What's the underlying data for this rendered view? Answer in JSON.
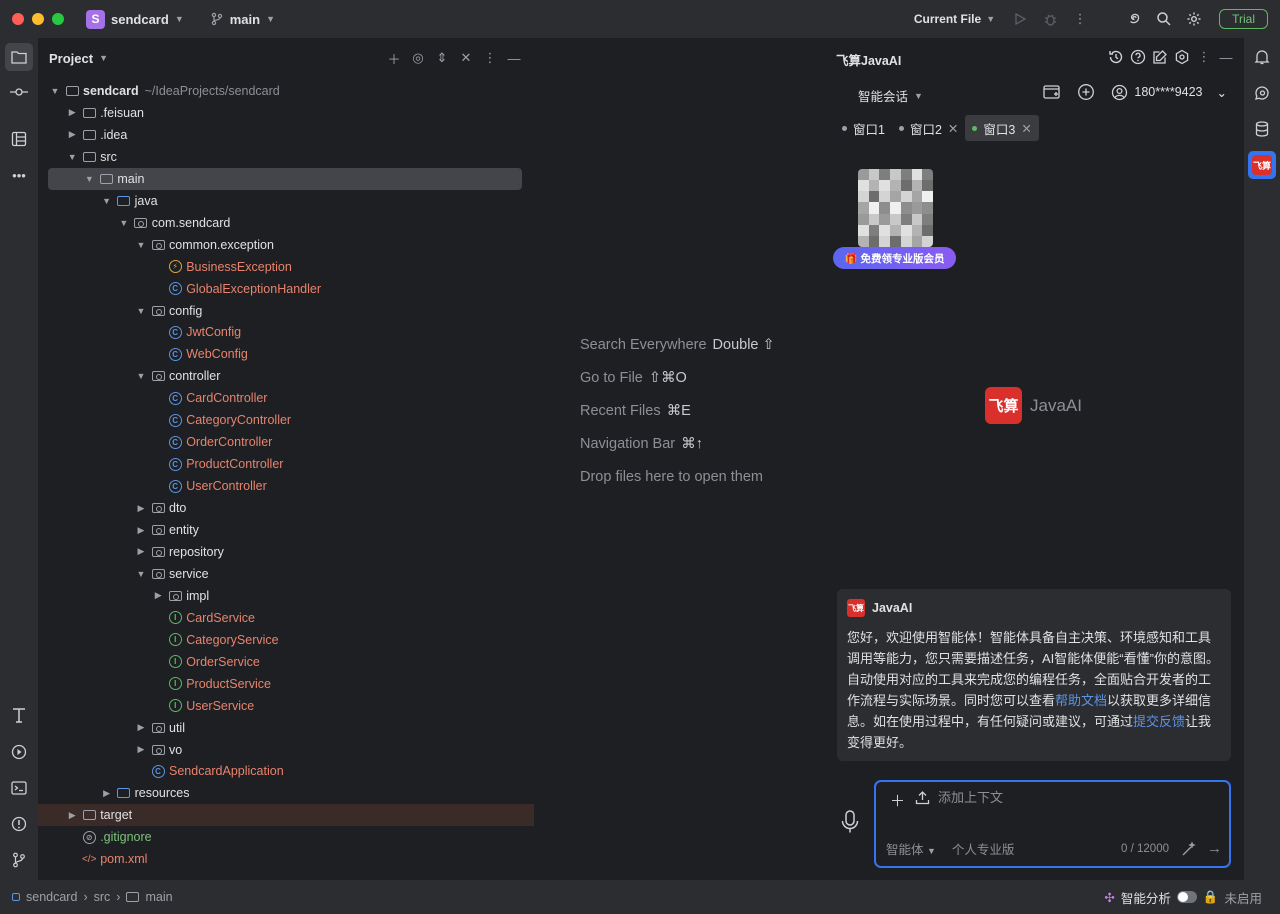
{
  "titlebar": {
    "project_initial": "S",
    "project_name": "sendcard",
    "branch": "main",
    "run_config": "Current File",
    "trial_label": "Trial"
  },
  "project_panel": {
    "title": "Project",
    "root_name": "sendcard",
    "root_path": "~/IdeaProjects/sendcard",
    "items": [
      {
        "label": ".feisuan"
      },
      {
        "label": ".idea"
      },
      {
        "label": "src"
      },
      {
        "label": "main"
      },
      {
        "label": "java"
      },
      {
        "label": "com.sendcard"
      },
      {
        "label": "common.exception"
      },
      {
        "label": "BusinessException"
      },
      {
        "label": "GlobalExceptionHandler"
      },
      {
        "label": "config"
      },
      {
        "label": "JwtConfig"
      },
      {
        "label": "WebConfig"
      },
      {
        "label": "controller"
      },
      {
        "label": "CardController"
      },
      {
        "label": "CategoryController"
      },
      {
        "label": "OrderController"
      },
      {
        "label": "ProductController"
      },
      {
        "label": "UserController"
      },
      {
        "label": "dto"
      },
      {
        "label": "entity"
      },
      {
        "label": "repository"
      },
      {
        "label": "service"
      },
      {
        "label": "impl"
      },
      {
        "label": "CardService"
      },
      {
        "label": "CategoryService"
      },
      {
        "label": "OrderService"
      },
      {
        "label": "ProductService"
      },
      {
        "label": "UserService"
      },
      {
        "label": "util"
      },
      {
        "label": "vo"
      },
      {
        "label": "SendcardApplication"
      },
      {
        "label": "resources"
      },
      {
        "label": "target"
      },
      {
        "label": ".gitignore"
      },
      {
        "label": "pom.xml"
      }
    ]
  },
  "editor": {
    "hints": [
      {
        "text": "Search Everywhere",
        "key": "Double ⇧"
      },
      {
        "text": "Go to File",
        "key": "⇧⌘O"
      },
      {
        "text": "Recent Files",
        "key": "⌘E"
      },
      {
        "text": "Navigation Bar",
        "key": "⌘↑"
      },
      {
        "text": "Drop files here to open them",
        "key": ""
      }
    ]
  },
  "ai_panel": {
    "title": "飞算JavaAI",
    "mode": "智能会话",
    "user": "180****9423",
    "tabs": [
      "窗口1",
      "窗口2",
      "窗口3"
    ],
    "vip_badge": "免费领专业版会员",
    "logo_mark": "飞算",
    "logo_text": "JavaAI",
    "message": {
      "sender": "JavaAI",
      "text_1": "您好，欢迎使用智能体！智能体具备自主决策、环境感知和工具调用等能力，您只需要描述任务，AI智能体便能“看懂”你的意图。自动使用对应的工具来完成您的编程任务，全面贴合开发者的工作流程与实际场景。同时您可以查看",
      "link_1": "帮助文档",
      "text_2": "以获取更多详细信息。如在使用过程中，有任何疑问或建议，可通过",
      "link_2": "提交反馈",
      "text_3": "让我变得更好。"
    },
    "input": {
      "placeholder": "添加上下文",
      "agent_mode": "智能体",
      "edition": "个人专业版",
      "counter": "0 / 12000"
    }
  },
  "statusbar": {
    "crumbs": [
      "sendcard",
      "src",
      "main"
    ],
    "analysis": "智能分析",
    "state": "未启用"
  },
  "colors": {
    "accent": "#3574f0",
    "brand_red": "#d9302c",
    "vip_gradient_start": "#5a66f0",
    "trial_green": "#5fb865"
  }
}
